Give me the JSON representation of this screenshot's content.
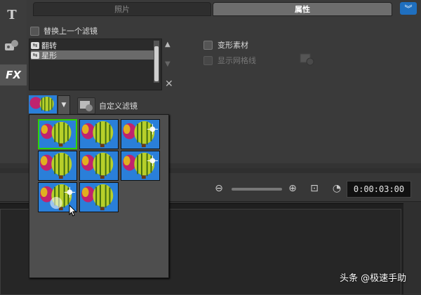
{
  "toolstrip": {
    "items": [
      {
        "label": "T",
        "icon": "title-icon"
      },
      {
        "label": "",
        "icon": "graphics-icon"
      },
      {
        "label": "FX",
        "icon": "fx-icon"
      }
    ]
  },
  "tabs": {
    "photo": "照片",
    "attributes": "属性"
  },
  "attributes": {
    "replace_filter_label": "替换上一个滤镜",
    "filters": [
      "翻转",
      "星形"
    ],
    "selected_filter_index": 1,
    "distort_clip_label": "变形素材",
    "show_grid_label": "显示网格线",
    "custom_filter_label": "自定义滤镜"
  },
  "playback": {
    "timecode": "0:00:03:00"
  },
  "preset_popup": {
    "rows": 3,
    "columns": 3,
    "preset_count": 8,
    "selected_index": 0
  },
  "watermark": "头条 @极速手助",
  "colors": {
    "tab_active": "#6d6d6d",
    "selection_border": "#2dd400",
    "collapse_button": "#1f6fbf",
    "sky_blue": "#2a7fd9"
  }
}
